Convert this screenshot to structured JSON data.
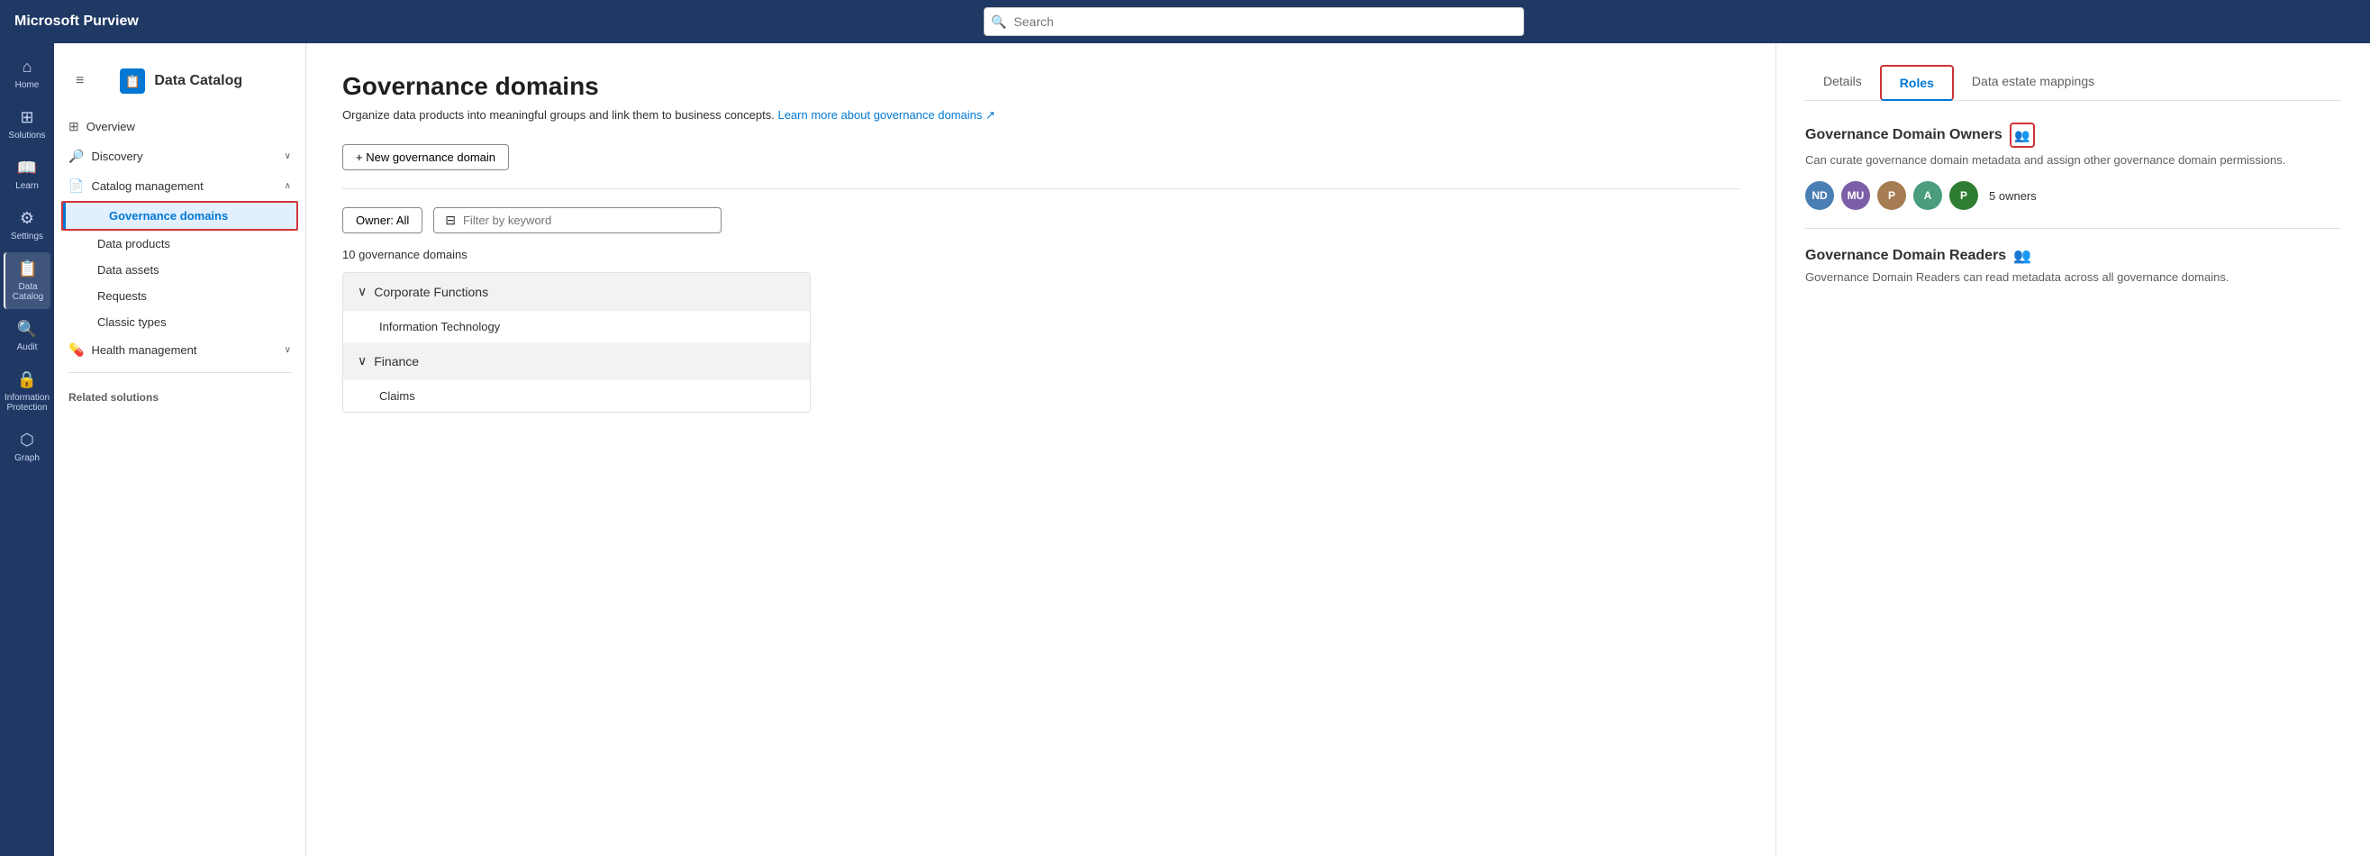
{
  "app": {
    "title": "Microsoft Purview"
  },
  "topbar": {
    "search_placeholder": "Search"
  },
  "icon_nav": {
    "items": [
      {
        "id": "home",
        "label": "Home",
        "icon": "⌂"
      },
      {
        "id": "solutions",
        "label": "Solutions",
        "icon": "⊞"
      },
      {
        "id": "learn",
        "label": "Learn",
        "icon": "📖"
      },
      {
        "id": "settings",
        "label": "Settings",
        "icon": "⚙"
      },
      {
        "id": "data-catalog",
        "label": "Data Catalog",
        "icon": "📋",
        "active": true
      },
      {
        "id": "audit",
        "label": "Audit",
        "icon": "🔍"
      },
      {
        "id": "info-protection",
        "label": "Information Protection",
        "icon": "🔒"
      },
      {
        "id": "graph",
        "label": "Graph",
        "icon": "⬡"
      }
    ]
  },
  "sidebar": {
    "hamburger_label": "≡",
    "header": {
      "title": "Data Catalog",
      "icon": "📋"
    },
    "items": [
      {
        "id": "overview",
        "label": "Overview",
        "icon": "⊞",
        "expandable": false
      },
      {
        "id": "discovery",
        "label": "Discovery",
        "icon": "🔎",
        "expandable": true
      },
      {
        "id": "catalog-management",
        "label": "Catalog management",
        "icon": "📄",
        "expandable": true,
        "expanded": true,
        "children": [
          {
            "id": "governance-domains",
            "label": "Governance domains",
            "active": true
          },
          {
            "id": "data-products",
            "label": "Data products"
          },
          {
            "id": "data-assets",
            "label": "Data assets"
          },
          {
            "id": "requests",
            "label": "Requests"
          },
          {
            "id": "classic-types",
            "label": "Classic types"
          }
        ]
      },
      {
        "id": "health-management",
        "label": "Health management",
        "icon": "💊",
        "expandable": true
      }
    ],
    "related_solutions_label": "Related solutions"
  },
  "main": {
    "page_title": "Governance domains",
    "page_subtitle": "Organize data products into meaningful groups and link them to business concepts.",
    "learn_more_text": "Learn more about governance domains",
    "learn_more_icon": "↗",
    "new_button_label": "+ New governance domain",
    "owner_filter": {
      "label": "Owner:",
      "value": "All"
    },
    "keyword_filter_placeholder": "Filter by keyword",
    "domain_count": "10 governance domains",
    "domains": [
      {
        "id": "corporate-functions",
        "label": "Corporate Functions",
        "expanded": true,
        "children": [
          {
            "id": "information-technology",
            "label": "Information Technology"
          }
        ]
      },
      {
        "id": "finance",
        "label": "Finance",
        "expanded": true,
        "children": [
          {
            "id": "claims",
            "label": "Claims"
          }
        ]
      }
    ]
  },
  "right_panel": {
    "tabs": [
      {
        "id": "details",
        "label": "Details",
        "active": false
      },
      {
        "id": "roles",
        "label": "Roles",
        "active": true
      },
      {
        "id": "data-estate-mappings",
        "label": "Data estate mappings",
        "active": false
      }
    ],
    "governance_domain_owners": {
      "title": "Governance Domain Owners",
      "description": "Can curate governance domain metadata and assign other governance domain permissions.",
      "avatars": [
        {
          "initials": "ND",
          "color": "#4a7fb5"
        },
        {
          "initials": "MU",
          "color": "#7b5ea7"
        },
        {
          "initials": "P",
          "color": "#a67c52"
        },
        {
          "initials": "A",
          "color": "#4a9e7d"
        },
        {
          "initials": "P",
          "color": "#2e7d32"
        }
      ],
      "owner_count": "5 owners"
    },
    "governance_domain_readers": {
      "title": "Governance Domain Readers",
      "description": "Governance Domain Readers can read metadata across all governance domains."
    }
  }
}
